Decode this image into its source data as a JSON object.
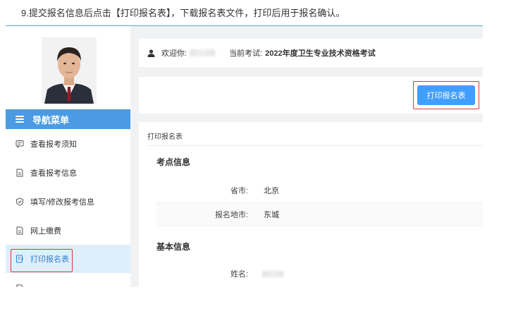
{
  "instruction": "9.提交报名信息后点击【打印报名表】，下载报名表文件，打印后用于报名确认。",
  "sidebar": {
    "nav_header": "导航菜单",
    "items": [
      {
        "label": "查看报考须知",
        "icon": "message-icon"
      },
      {
        "label": "查看报考信息",
        "icon": "document-icon"
      },
      {
        "label": "填写/修改报考信息",
        "icon": "shield-check-icon"
      },
      {
        "label": "网上缴费",
        "icon": "document-icon"
      },
      {
        "label": "打印报名表",
        "icon": "print-form-icon",
        "active": true
      }
    ]
  },
  "userbar": {
    "welcome": "欢迎你:",
    "exam_prefix": "当前考试:",
    "exam_name": "2022年度卫生专业技术资格考试"
  },
  "actions": {
    "print_button": "打印报名表"
  },
  "content": {
    "title": "打印报名表",
    "sections": [
      {
        "title": "考点信息",
        "rows": [
          {
            "label": "省市:",
            "value": "北京"
          },
          {
            "label": "报名地市:",
            "value": "东城"
          }
        ]
      },
      {
        "title": "基本信息",
        "rows": [
          {
            "label": "姓名:",
            "value": ""
          }
        ]
      }
    ]
  },
  "colors": {
    "accent": "#4a9be3",
    "button": "#409eff",
    "highlight": "#d9363e"
  }
}
